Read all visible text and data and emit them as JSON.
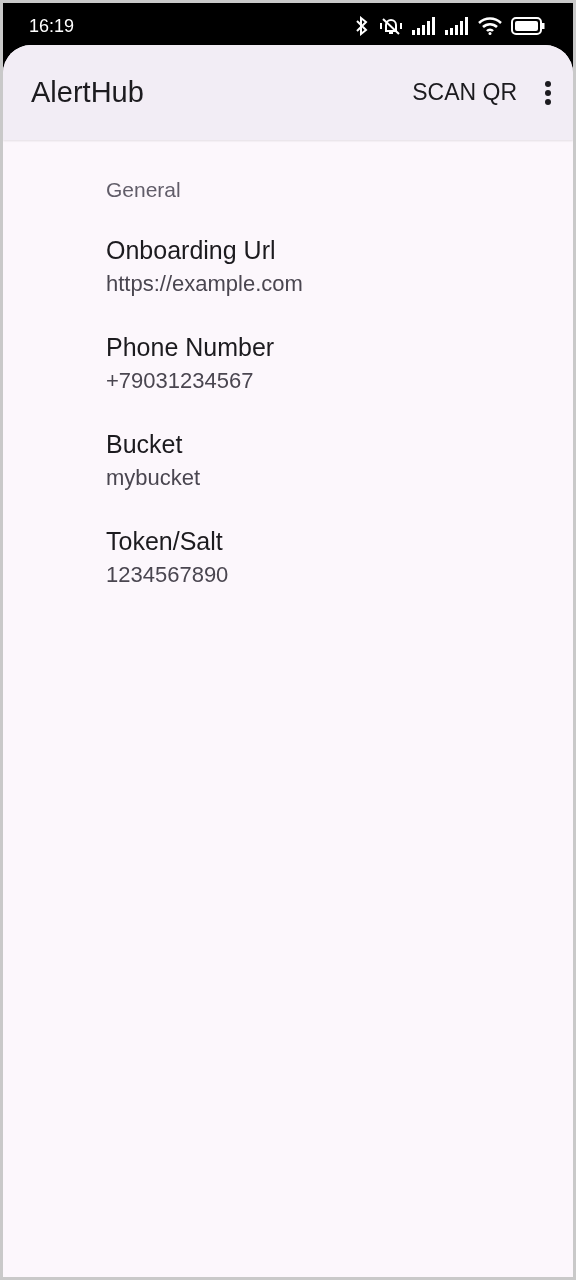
{
  "status_bar": {
    "time": "16:19"
  },
  "app_bar": {
    "title": "AlertHub",
    "action": "SCAN QR"
  },
  "section": {
    "title": "General"
  },
  "settings": [
    {
      "title": "Onboarding Url",
      "value": "https://example.com"
    },
    {
      "title": "Phone Number",
      "value": "+79031234567"
    },
    {
      "title": "Bucket",
      "value": "mybucket"
    },
    {
      "title": "Token/Salt",
      "value": "1234567890"
    }
  ]
}
